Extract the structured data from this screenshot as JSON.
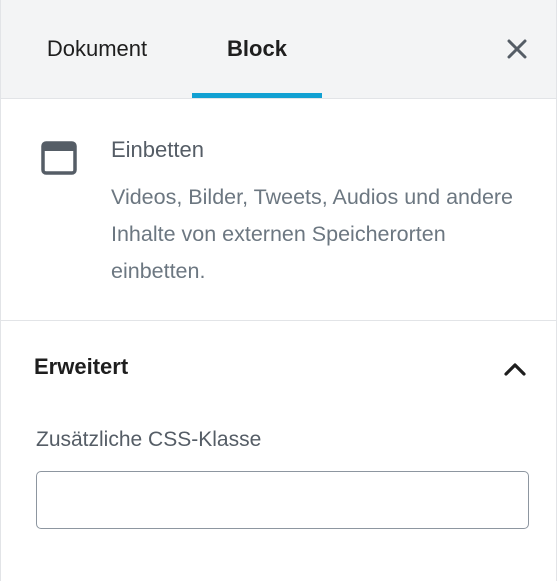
{
  "tabs": {
    "document_label": "Dokument",
    "block_label": "Block",
    "active": "Block",
    "close_icon": "close-icon"
  },
  "block": {
    "icon": "embed-window-icon",
    "title": "Einbetten",
    "description": "Videos, Bilder, Tweets, Audios und andere Inhalte von externen Speicherorten einbetten."
  },
  "advanced": {
    "title": "Erweitert",
    "expanded": true,
    "chevron_icon": "chevron-up-icon",
    "css_class_label": "Zusätzliche CSS-Klasse",
    "css_class_value": ""
  },
  "colors": {
    "accent": "#11a0d2",
    "header_bg": "#f3f4f5",
    "border": "#e2e4e7"
  }
}
